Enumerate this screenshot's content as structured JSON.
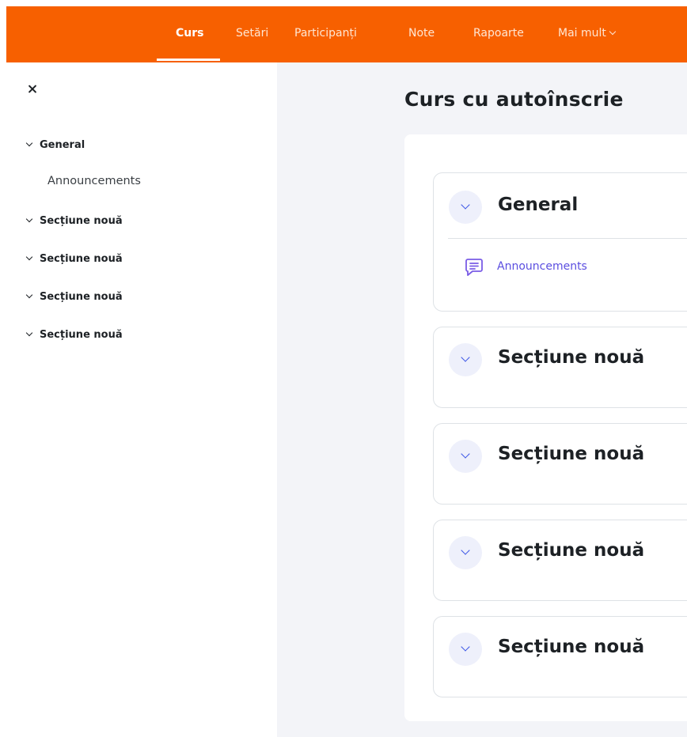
{
  "topnav": {
    "items": [
      {
        "label": "Curs",
        "active": true
      },
      {
        "label": "Setări",
        "active": false
      },
      {
        "label": "Participanți",
        "active": false
      },
      {
        "label": "Note",
        "active": false
      },
      {
        "label": "Rapoarte",
        "active": false
      },
      {
        "label": "Mai mult",
        "active": false
      }
    ]
  },
  "course_index": {
    "close_icon": "close-icon",
    "items": [
      {
        "label": "General",
        "expanded": true,
        "children": [
          "Announcements"
        ]
      },
      {
        "label": "Secțiune nouă",
        "expanded": true
      },
      {
        "label": "Secțiune nouă",
        "expanded": true
      },
      {
        "label": "Secțiune nouă",
        "expanded": true
      },
      {
        "label": "Secțiune nouă",
        "expanded": true
      }
    ]
  },
  "page": {
    "title": "Curs cu autoînscrie"
  },
  "sections": [
    {
      "title": "General",
      "activities": [
        {
          "name": "Announcements",
          "icon": "forum-icon"
        }
      ]
    },
    {
      "title": "Secțiune nouă"
    },
    {
      "title": "Secțiune nouă"
    },
    {
      "title": "Secțiune nouă"
    },
    {
      "title": "Secțiune nouă"
    }
  ],
  "colors": {
    "brand": "#f76000",
    "accent": "#3b55e6",
    "link": "#5b4ee0",
    "activity_icon": "#7a5ce6"
  }
}
